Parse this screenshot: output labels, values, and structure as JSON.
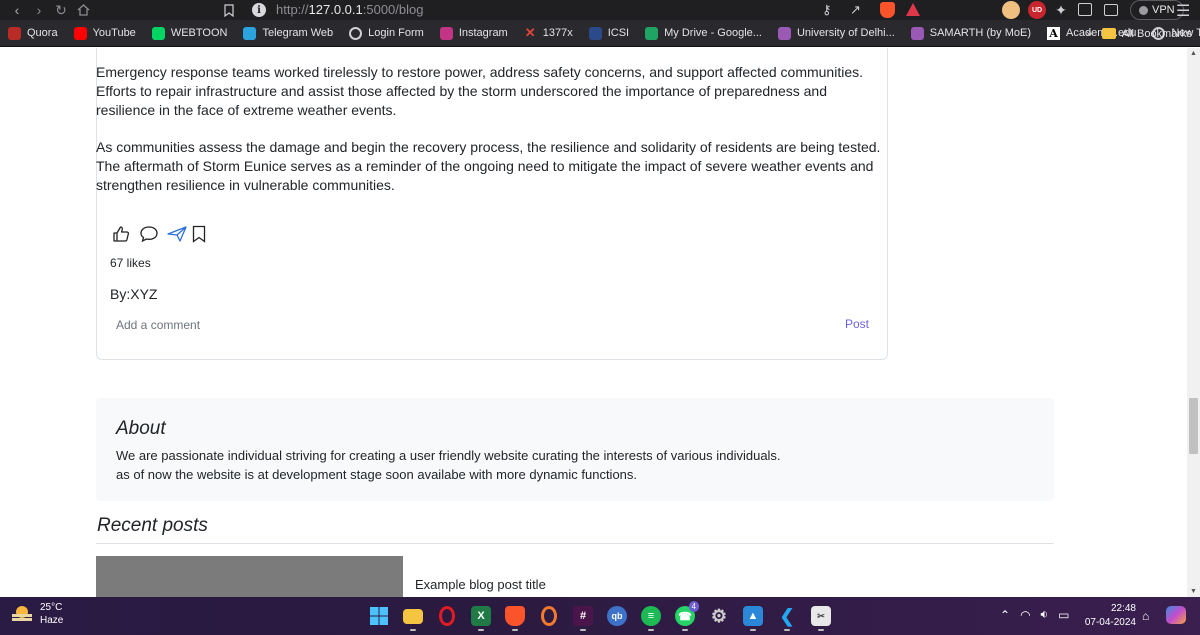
{
  "browser": {
    "url_prefix": "http://",
    "url_host": "127.0.0.1",
    "url_rest": ":5000/blog",
    "vpn_label": "VPN",
    "extension_badge": "UD"
  },
  "bookmarks": [
    {
      "label": "Quora",
      "icon": "quora-icon",
      "color": "#b92b27"
    },
    {
      "label": "YouTube",
      "icon": "youtube-icon",
      "color": "#ff0000"
    },
    {
      "label": "WEBTOON",
      "icon": "webtoon-icon",
      "color": "#00d564"
    },
    {
      "label": "Telegram Web",
      "icon": "telegram-icon",
      "color": "#2aa3df"
    },
    {
      "label": "Login Form",
      "icon": "globe-icon",
      "color": "#cfcfd4"
    },
    {
      "label": "Instagram",
      "icon": "instagram-icon",
      "color": "#c13584"
    },
    {
      "label": "1377x",
      "icon": "x-icon",
      "color": "#e0443a"
    },
    {
      "label": "ICSI",
      "icon": "icsi-icon",
      "color": "#2a4a8a"
    },
    {
      "label": "My Drive - Google...",
      "icon": "drive-icon",
      "color": "#1fa463"
    },
    {
      "label": "University of Delhi...",
      "icon": "du-icon",
      "color": "#9b59b6"
    },
    {
      "label": "SAMARTH (by MoE)",
      "icon": "samarth-icon",
      "color": "#9b59b6"
    },
    {
      "label": "Academia.edu",
      "icon": "academia-icon",
      "color": "#ffffff"
    },
    {
      "label": "New Tab",
      "icon": "globe-icon",
      "color": "#cfcfd4"
    }
  ],
  "bookmarks_more": "»",
  "bookmarks_all": "All Bookmarks",
  "post": {
    "paragraph_1": "Emergency response teams worked tirelessly to restore power, address safety concerns, and support affected communities. Efforts to repair infrastructure and assist those affected by the storm underscored the importance of preparedness and resilience in the face of extreme weather events.",
    "paragraph_2": "As communities assess the damage and begin the recovery process, the resilience and solidarity of residents are being tested. The aftermath of Storm Eunice serves as a reminder of the ongoing need to mitigate the impact of severe weather events and strengthen resilience in vulnerable communities.",
    "likes": "67 likes",
    "byline": "By:XYZ",
    "comment_placeholder": "Add a comment",
    "post_button": "Post"
  },
  "about": {
    "title": "About",
    "line_1": "We are passionate individual striving for creating a user friendly website curating the interests of various individuals.",
    "line_2": "as of now the website is at development stage soon availabe with more dynamic functions."
  },
  "recent": {
    "title": "Recent posts",
    "first_post_title": "Example blog post title"
  },
  "taskbar": {
    "temperature": "25°C",
    "weather": "Haze",
    "time": "22:48",
    "date": "07-04-2024",
    "whatsapp_badge": "4"
  }
}
